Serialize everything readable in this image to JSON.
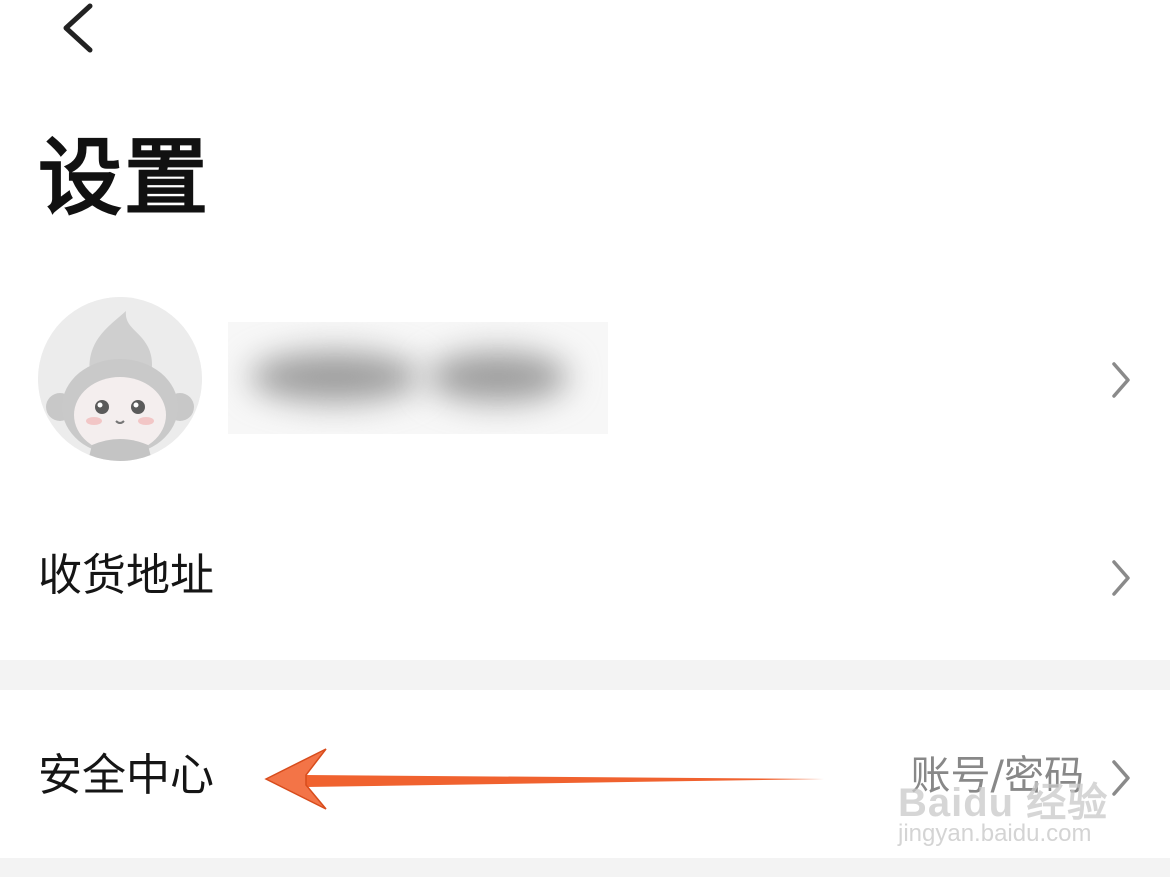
{
  "header": {
    "back_icon": "chevron-left-icon",
    "title": "设置"
  },
  "profile": {
    "avatar_icon": "monkey-mascot-avatar"
  },
  "menu": {
    "address_label": "收货地址",
    "security_label": "安全中心",
    "security_value": "账号/密码"
  },
  "watermark": {
    "logo": "Baidu 经验",
    "url": "jingyan.baidu.com"
  },
  "colors": {
    "annotation_arrow": "#f0622f",
    "divider_band": "#f3f3f3",
    "chevron": "#8a8a8a"
  }
}
